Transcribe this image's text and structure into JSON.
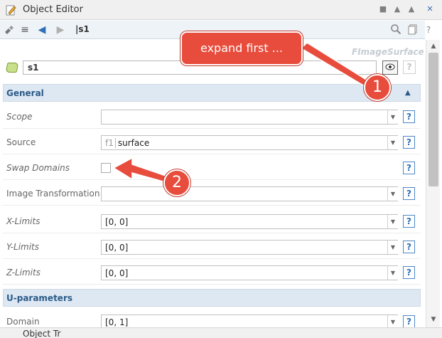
{
  "window": {
    "title": "Object Editor"
  },
  "toolbar": {
    "path": "|s1"
  },
  "object": {
    "class_name": "FImageSurface",
    "name": "s1",
    "help_label": "?"
  },
  "sections": {
    "general": "General",
    "u_parameters": "U-parameters"
  },
  "properties": [
    {
      "label": "Scope",
      "value": "",
      "prefix": ""
    },
    {
      "label": "Source",
      "value": "surface",
      "prefix": "f1"
    },
    {
      "label": "Swap Domains"
    },
    {
      "label": "Image Transformation",
      "value": "",
      "prefix": ""
    },
    {
      "label": "X-Limits",
      "value": "[0, 0]",
      "prefix": ""
    },
    {
      "label": "Y-Limits",
      "value": "[0, 0]",
      "prefix": ""
    },
    {
      "label": "Z-Limits",
      "value": "[0, 0]",
      "prefix": ""
    },
    {
      "label": "Domain",
      "value": "[0, 1]",
      "prefix": ""
    }
  ],
  "help": "?",
  "annotations": {
    "callout": "expand first ...",
    "badge_1": "1",
    "badge_2": "2",
    "color": "#e74c3c"
  },
  "bottom_panel": {
    "title": "Object Tr"
  }
}
